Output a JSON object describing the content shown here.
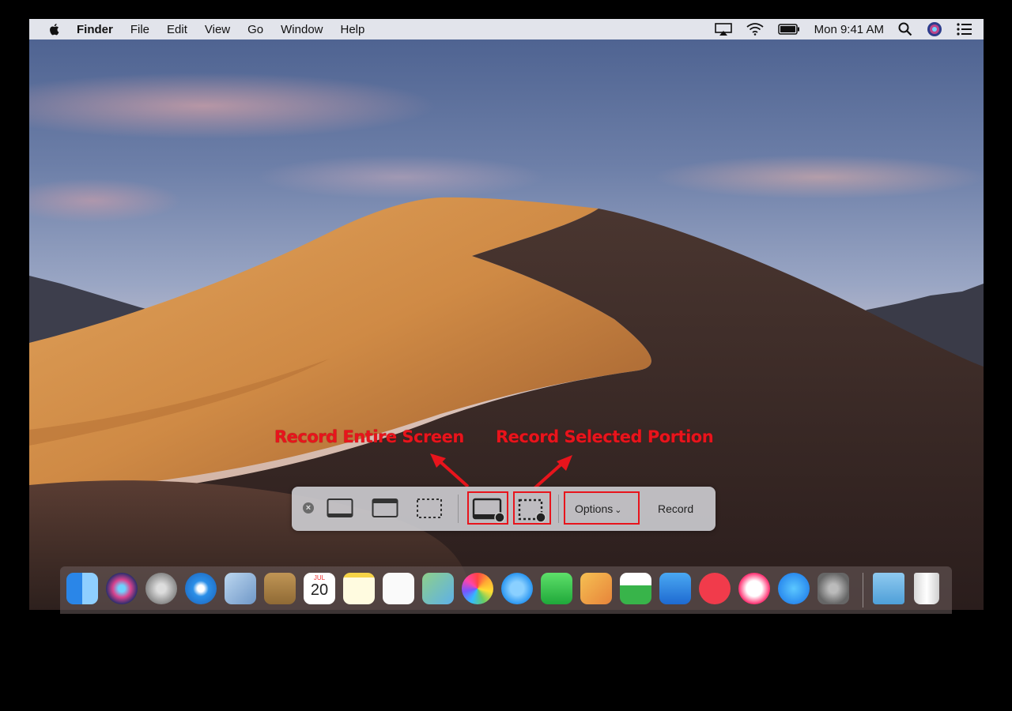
{
  "menubar": {
    "app": "Finder",
    "items": [
      "File",
      "Edit",
      "View",
      "Go",
      "Window",
      "Help"
    ],
    "clock": "Mon 9:41 AM"
  },
  "annotations": {
    "entire": "Record Entire Screen",
    "selected": "Record Selected Portion",
    "color": "#e8141c"
  },
  "toolbar": {
    "close": "×",
    "options_label": "Options",
    "record_label": "Record"
  },
  "dock": {
    "icons": [
      "finder-icon",
      "siri-icon",
      "launchpad-icon",
      "safari-icon",
      "mail-icon",
      "contacts-icon",
      "calendar-icon",
      "notes-icon",
      "reminders-icon",
      "maps-icon",
      "photos-icon",
      "messages-icon",
      "facetime-icon",
      "pages-icon",
      "numbers-icon",
      "keynote-icon",
      "news-icon",
      "itunes-icon",
      "app-store-icon",
      "system-preferences-icon",
      "downloads-folder-icon",
      "trash-icon"
    ],
    "calendar_day": "20",
    "calendar_month": "JUL"
  }
}
